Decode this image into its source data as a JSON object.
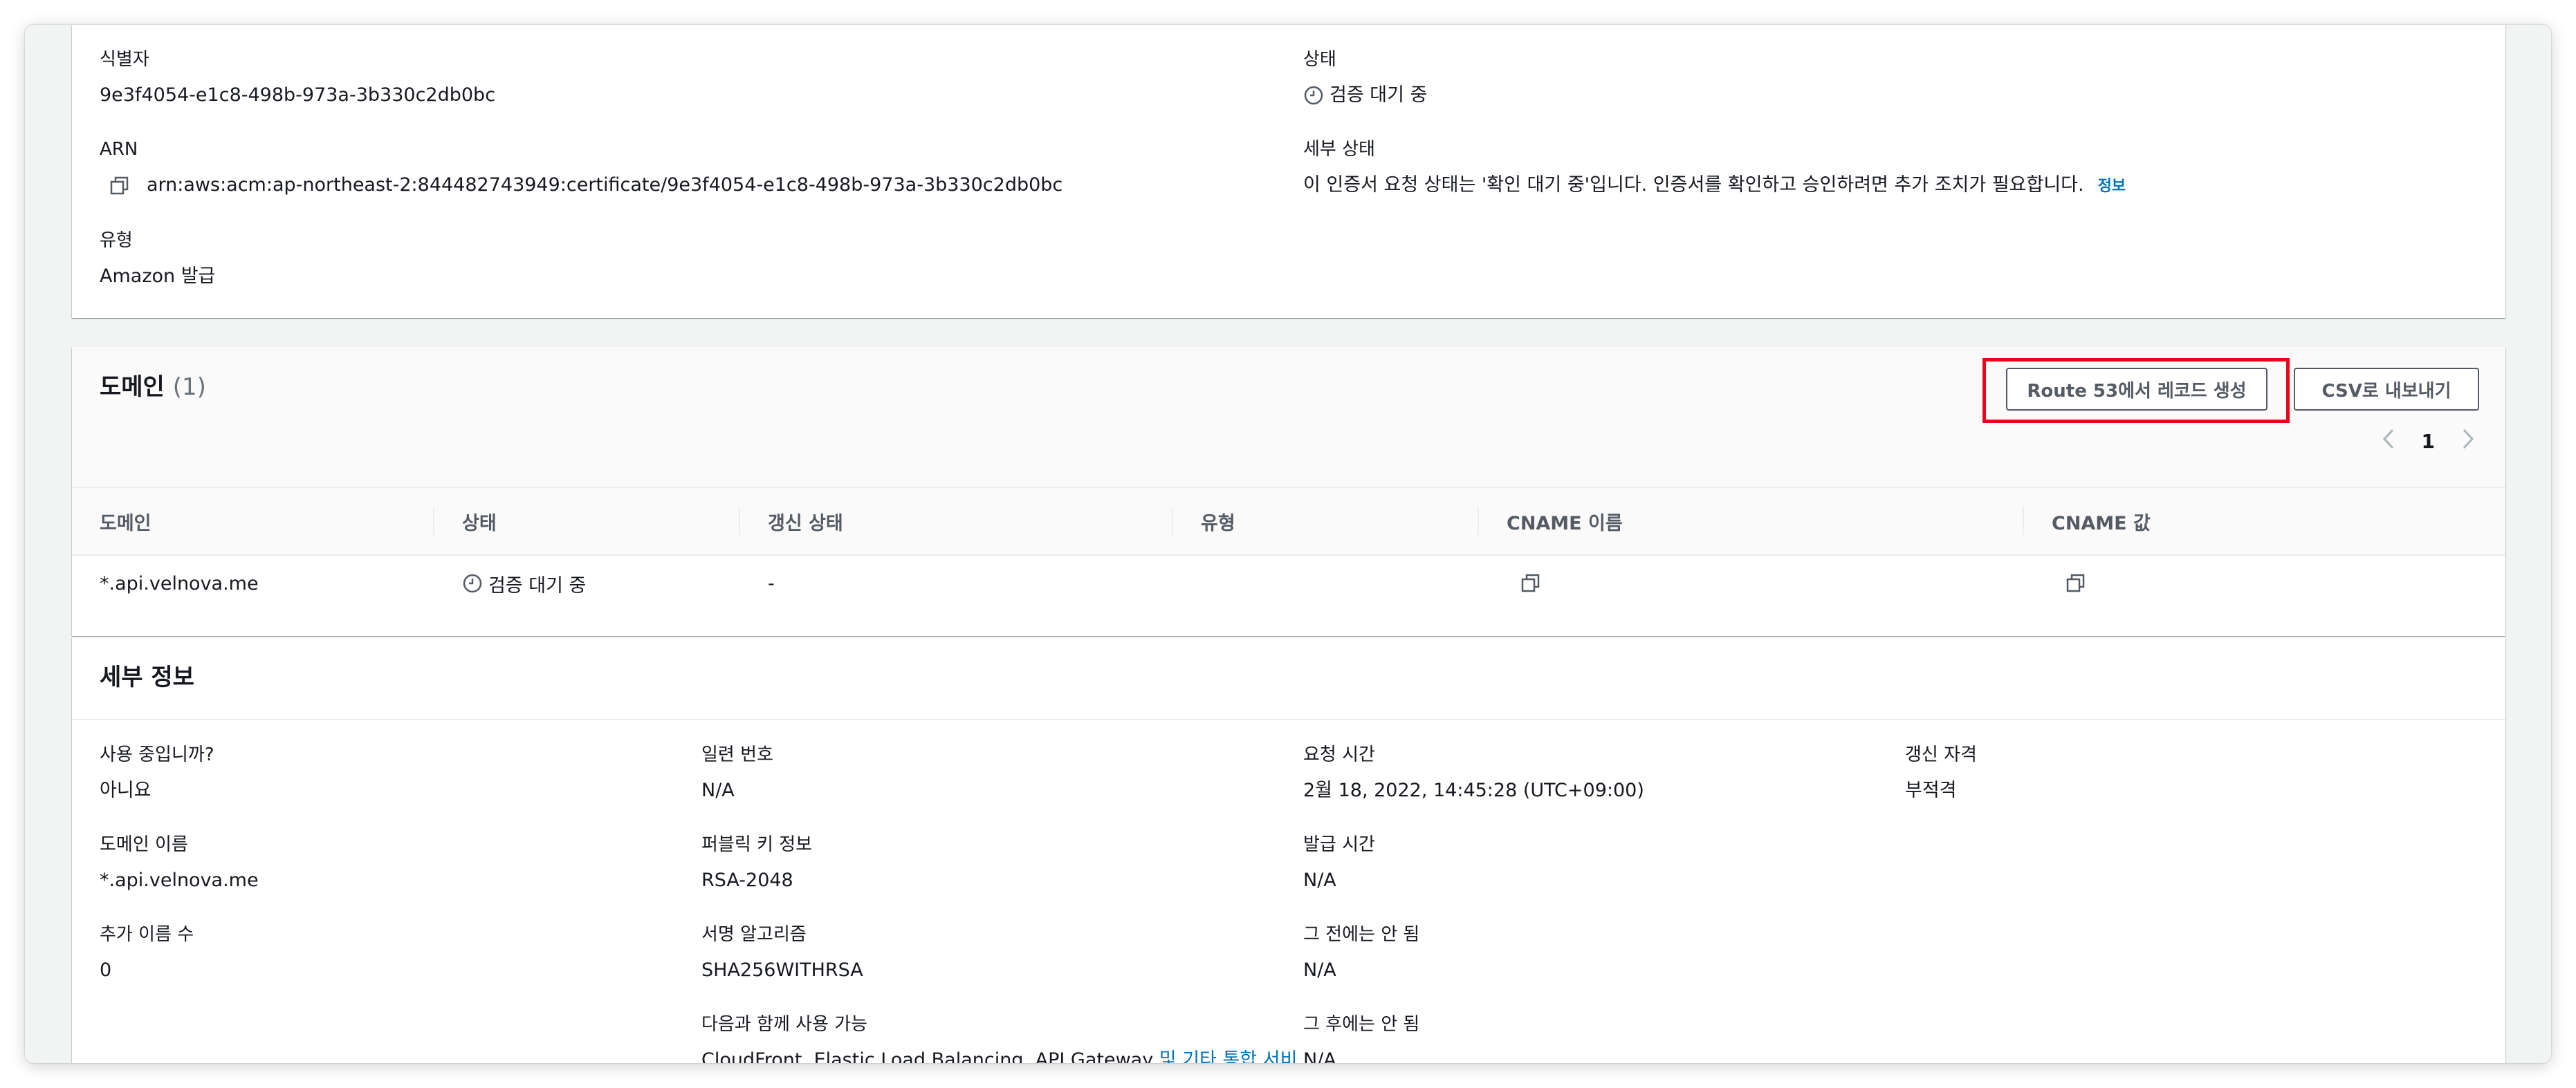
{
  "general": {
    "identifier": {
      "label": "식별자",
      "value": "9e3f4054-e1c8-498b-973a-3b330c2db0bc"
    },
    "arn": {
      "label": "ARN",
      "value": "arn:aws:acm:ap-northeast-2:844482743949:certificate/9e3f4054-e1c8-498b-973a-3b330c2db0bc"
    },
    "type": {
      "label": "유형",
      "value": "Amazon 발급"
    },
    "status": {
      "label": "상태",
      "value": "검증 대기 중"
    },
    "detail_status": {
      "label": "세부 상태",
      "value": "이 인증서 요청 상태는 '확인 대기 중'입니다. 인증서를 확인하고 승인하려면 추가 조치가 필요합니다.",
      "info_link": "정보"
    }
  },
  "domains": {
    "title": "도메인",
    "count": "(1)",
    "buttons": {
      "route53": "Route 53에서 레코드 생성",
      "export_csv": "CSV로 내보내기"
    },
    "pagination": {
      "current_page": "1"
    },
    "columns": [
      "도메인",
      "상태",
      "갱신 상태",
      "유형",
      "CNAME 이름",
      "CNAME 값"
    ],
    "rows": [
      {
        "domain": "*.api.velnova.me",
        "status": "검증 대기 중",
        "renewal_status": "-",
        "type": ""
      }
    ]
  },
  "details": {
    "title": "세부 정보",
    "in_use": {
      "label": "사용 중입니까?",
      "value": "아니요"
    },
    "domain_name": {
      "label": "도메인 이름",
      "value": "*.api.velnova.me"
    },
    "additional_names": {
      "label": "추가 이름 수",
      "value": "0"
    },
    "serial_number": {
      "label": "일련 번호",
      "value": "N/A"
    },
    "public_key_info": {
      "label": "퍼블릭 키 정보",
      "value": "RSA-2048"
    },
    "signature_algorithm": {
      "label": "서명 알고리즘",
      "value": "SHA256WITHRSA"
    },
    "usable_with": {
      "label": "다음과 함께 사용 가능",
      "value": "CloudFront, Elastic Load Balancing, API Gateway",
      "link": "및 기타 통합 서비"
    },
    "requested_at": {
      "label": "요청 시간",
      "value": "2월 18, 2022, 14:45:28 (UTC+09:00)"
    },
    "issued_at": {
      "label": "발급 시간",
      "value": "N/A"
    },
    "not_before": {
      "label": "그 전에는 안 됨",
      "value": "N/A"
    },
    "not_after": {
      "label": "그 후에는 안 됨",
      "value": "N/A"
    },
    "renewal_eligibility": {
      "label": "갱신 자격",
      "value": "부적격"
    }
  },
  "icons": {
    "copy": "copy-icon",
    "clock": "clock-icon",
    "chevron_left": "chevron-left-icon",
    "chevron_right": "chevron-right-icon"
  },
  "colors": {
    "link": "#0073bb",
    "highlight": "#e8051b",
    "button_border": "#545b64"
  }
}
